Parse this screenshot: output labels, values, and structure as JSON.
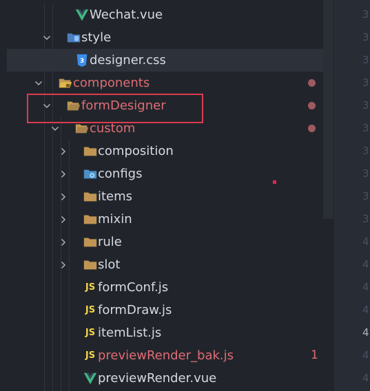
{
  "tree": [
    {
      "label": "Wechat.vue",
      "icon": "vue-icon",
      "name": "file-wechat-vue",
      "indent": 3,
      "type": "file"
    },
    {
      "label": "style",
      "icon": "folder-style-icon",
      "name": "folder-style",
      "indent": 2,
      "type": "folder",
      "open": true
    },
    {
      "label": "designer.css",
      "icon": "css-icon",
      "name": "file-designer-css",
      "indent": 3,
      "type": "file",
      "selected": true
    },
    {
      "label": "components",
      "icon": "folder-components-icon",
      "name": "folder-components",
      "indent": 1,
      "type": "folder",
      "open": true,
      "error": true,
      "dot": true
    },
    {
      "label": "formDesigner",
      "icon": "folder-open-icon",
      "name": "folder-formdesigner",
      "indent": 2,
      "type": "folder",
      "open": true,
      "error": true,
      "dot": true
    },
    {
      "label": "custom",
      "icon": "folder-open-icon",
      "name": "folder-custom",
      "indent": 3,
      "type": "folder",
      "open": true,
      "error": true,
      "dot": true
    },
    {
      "label": "composition",
      "icon": "folder-icon",
      "name": "folder-composition",
      "indent": 4,
      "type": "folder",
      "open": false
    },
    {
      "label": "configs",
      "icon": "folder-config-icon",
      "name": "folder-configs",
      "indent": 4,
      "type": "folder",
      "open": false
    },
    {
      "label": "items",
      "icon": "folder-icon",
      "name": "folder-items",
      "indent": 4,
      "type": "folder",
      "open": false
    },
    {
      "label": "mixin",
      "icon": "folder-icon",
      "name": "folder-mixin",
      "indent": 4,
      "type": "folder",
      "open": false
    },
    {
      "label": "rule",
      "icon": "folder-icon",
      "name": "folder-rule",
      "indent": 4,
      "type": "folder",
      "open": false
    },
    {
      "label": "slot",
      "icon": "folder-icon",
      "name": "folder-slot",
      "indent": 4,
      "type": "folder",
      "open": false
    },
    {
      "label": "formConf.js",
      "icon": "js-icon",
      "name": "file-formconf-js",
      "indent": 4,
      "type": "file"
    },
    {
      "label": "formDraw.js",
      "icon": "js-icon",
      "name": "file-formdraw-js",
      "indent": 4,
      "type": "file"
    },
    {
      "label": "itemList.js",
      "icon": "js-icon",
      "name": "file-itemlist-js",
      "indent": 4,
      "type": "file"
    },
    {
      "label": "previewRender_bak.js",
      "icon": "js-icon",
      "name": "file-previewrender-bak-js",
      "indent": 4,
      "type": "file",
      "error": true,
      "badge": "1"
    },
    {
      "label": "previewRender.vue",
      "icon": "vue-icon",
      "name": "file-previewrender-vue",
      "indent": 4,
      "type": "file"
    }
  ],
  "line_numbers": [
    "3",
    "3",
    "3",
    "3",
    "3",
    "3",
    "3",
    "3",
    "3",
    "3",
    "4",
    "4",
    "4",
    "4",
    "4",
    "4",
    "4"
  ],
  "current_line_indices": [
    14
  ],
  "colors": {
    "error": "#e06c75",
    "folder": "#c09553",
    "vue": "#41b883",
    "css": "#3b8eea",
    "js": "#f5d44a",
    "highlight_box": "#e03a4e"
  }
}
